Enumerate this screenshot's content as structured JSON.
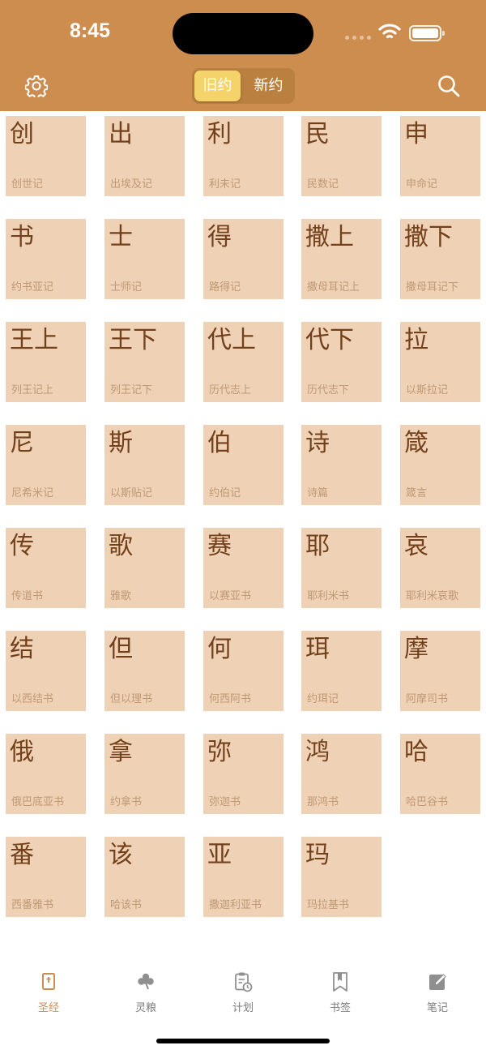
{
  "status_bar": {
    "time": "8:45"
  },
  "header": {
    "settings_icon": "gear-icon",
    "search_icon": "search-icon",
    "segments": [
      {
        "label": "旧约",
        "selected": true
      },
      {
        "label": "新约",
        "selected": false
      }
    ]
  },
  "books": [
    {
      "abbr": "创",
      "name": "创世记"
    },
    {
      "abbr": "出",
      "name": "出埃及记"
    },
    {
      "abbr": "利",
      "name": "利未记"
    },
    {
      "abbr": "民",
      "name": "民数记"
    },
    {
      "abbr": "申",
      "name": "申命记"
    },
    {
      "abbr": "书",
      "name": "约书亚记"
    },
    {
      "abbr": "士",
      "name": "士师记"
    },
    {
      "abbr": "得",
      "name": "路得记"
    },
    {
      "abbr": "撒上",
      "name": "撒母耳记上"
    },
    {
      "abbr": "撒下",
      "name": "撒母耳记下"
    },
    {
      "abbr": "王上",
      "name": "列王记上"
    },
    {
      "abbr": "王下",
      "name": "列王记下"
    },
    {
      "abbr": "代上",
      "name": "历代志上"
    },
    {
      "abbr": "代下",
      "name": "历代志下"
    },
    {
      "abbr": "拉",
      "name": "以斯拉记"
    },
    {
      "abbr": "尼",
      "name": "尼希米记"
    },
    {
      "abbr": "斯",
      "name": "以斯贴记"
    },
    {
      "abbr": "伯",
      "name": "约伯记"
    },
    {
      "abbr": "诗",
      "name": "诗篇"
    },
    {
      "abbr": "箴",
      "name": "箴言"
    },
    {
      "abbr": "传",
      "name": "传道书"
    },
    {
      "abbr": "歌",
      "name": "雅歌"
    },
    {
      "abbr": "赛",
      "name": "以赛亚书"
    },
    {
      "abbr": "耶",
      "name": "耶利米书"
    },
    {
      "abbr": "哀",
      "name": "耶利米哀歌"
    },
    {
      "abbr": "结",
      "name": "以西结书"
    },
    {
      "abbr": "但",
      "name": "但以理书"
    },
    {
      "abbr": "何",
      "name": "何西阿书"
    },
    {
      "abbr": "珥",
      "name": "约珥记"
    },
    {
      "abbr": "摩",
      "name": "阿摩司书"
    },
    {
      "abbr": "俄",
      "name": "俄巴底亚书"
    },
    {
      "abbr": "拿",
      "name": "约拿书"
    },
    {
      "abbr": "弥",
      "name": "弥迦书"
    },
    {
      "abbr": "鸿",
      "name": "那鸿书"
    },
    {
      "abbr": "哈",
      "name": "哈巴谷书"
    },
    {
      "abbr": "番",
      "name": "西番雅书"
    },
    {
      "abbr": "该",
      "name": "哈该书"
    },
    {
      "abbr": "亚",
      "name": "撒迦利亚书"
    },
    {
      "abbr": "玛",
      "name": "玛拉基书"
    }
  ],
  "tabs": [
    {
      "label": "圣经",
      "icon": "bible-icon",
      "active": true
    },
    {
      "label": "灵粮",
      "icon": "clover-icon",
      "active": false
    },
    {
      "label": "计划",
      "icon": "clipboard-clock-icon",
      "active": false
    },
    {
      "label": "书签",
      "icon": "bookmark-icon",
      "active": false
    },
    {
      "label": "笔记",
      "icon": "note-pencil-icon",
      "active": false
    }
  ],
  "colors": {
    "header": "#cd8d4f",
    "tile": "#efd2b5",
    "tile_text": "#73401c",
    "tile_subtext": "#bf9874",
    "selected_segment": "#f5d36b",
    "active_tab": "#cd8d4f"
  }
}
